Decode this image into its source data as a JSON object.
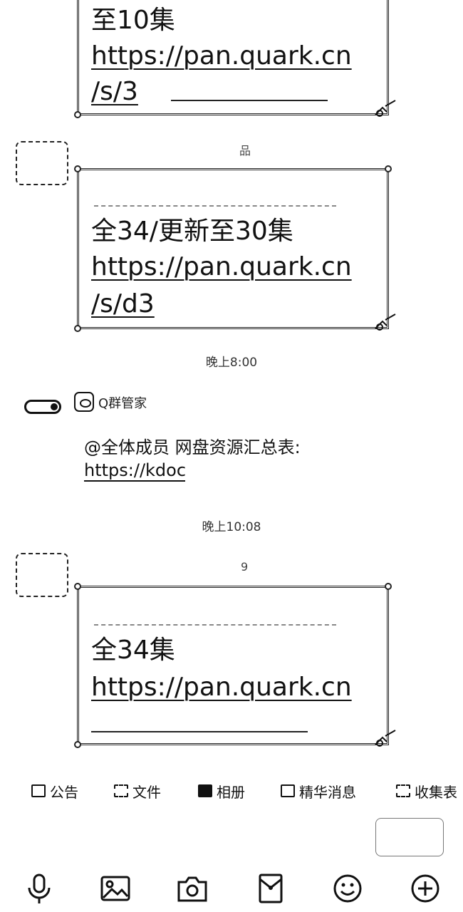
{
  "messages": [
    {
      "lines": [
        "至10集",
        "https://pan.quark.cn",
        "/s/3"
      ]
    },
    {
      "sender_suffix": "品",
      "lines": [
        "全34/更新至30集",
        "https://pan.quark.cn",
        "/s/d3"
      ]
    }
  ],
  "time_1": "晚上8:00",
  "system_message": {
    "sender": "Q群管家",
    "line1": "@全体成员 网盘资源汇总表:",
    "line2": "https://kdoc"
  },
  "time_2": "晚上10:08",
  "message_3": {
    "sender_suffix": "9",
    "lines": [
      "全34集",
      "https://pan.quark.cn"
    ]
  },
  "toolbar": [
    {
      "label": "公告",
      "icon": "announcement-icon"
    },
    {
      "label": "文件",
      "icon": "folder-icon"
    },
    {
      "label": "相册",
      "icon": "album-icon"
    },
    {
      "label": "精华消息",
      "icon": "highlight-icon"
    },
    {
      "label": "收集表",
      "icon": "form-icon"
    }
  ],
  "bottom_bar": [
    "mic-icon",
    "image-icon",
    "camera-icon",
    "red-packet-icon",
    "emoji-icon",
    "plus-icon"
  ]
}
